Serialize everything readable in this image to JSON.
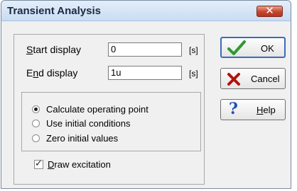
{
  "window": {
    "title": "Transient Analysis",
    "close_icon": "close-icon"
  },
  "fields": {
    "start": {
      "label_mnemonic": "S",
      "label_rest": "tart display",
      "value": "0",
      "unit": "[s]"
    },
    "end": {
      "label_pre": "E",
      "label_mnemonic": "n",
      "label_rest": "d display",
      "value": "1u",
      "unit": "[s]"
    }
  },
  "options": [
    {
      "label": "Calculate operating point",
      "checked": true
    },
    {
      "label": "Use initial conditions",
      "checked": false
    },
    {
      "label": "Zero initial values",
      "checked": false
    }
  ],
  "draw_excitation": {
    "mnemonic": "D",
    "label_rest": "raw excitation",
    "checked": true
  },
  "buttons": {
    "ok": {
      "label": "OK",
      "icon": "checkmark-icon",
      "icon_color": "#2e9a2e"
    },
    "cancel": {
      "label": "Cancel",
      "icon": "cross-icon",
      "icon_color": "#b0140f"
    },
    "help": {
      "mnemonic": "H",
      "label_rest": "elp",
      "icon": "question-icon",
      "icon_color": "#1f4fb5"
    }
  }
}
